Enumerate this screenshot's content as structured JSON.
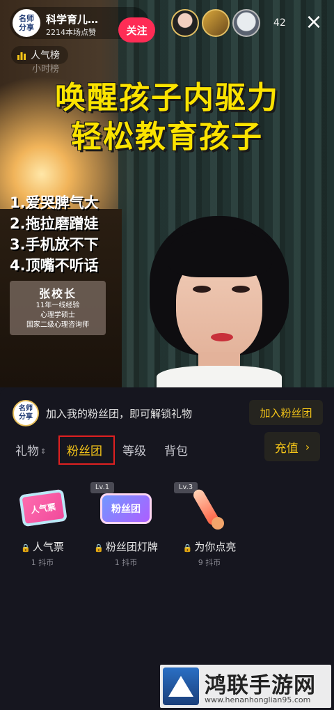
{
  "header": {
    "host_avatar_line1": "名师",
    "host_avatar_line2": "分享",
    "host_name": "科学育儿…",
    "host_likes": "2214本场点赞",
    "follow_label": "关注",
    "viewer_count": "42",
    "close_icon": "×"
  },
  "rank": {
    "label": "人气榜",
    "sub": "小时榜"
  },
  "video": {
    "headline_1": "唤醒孩子内驱力",
    "headline_2": "轻松教育孩子",
    "points": [
      "1.爱哭脾气大",
      "2.拖拉磨蹭娃",
      "3.手机放不下",
      "4.顶嘴不听话"
    ],
    "card_name": "张校长",
    "card_lines": [
      "11年一线经验",
      "心理学硕士",
      "国家二级心理咨询师"
    ]
  },
  "panel": {
    "fan_avatar_line1": "名师",
    "fan_avatar_line2": "分享",
    "fan_hint": "加入我的粉丝团，即可解锁礼物",
    "join_label": "加入粉丝团",
    "tabs": {
      "gift": "礼物",
      "fans": "粉丝团",
      "level": "等级",
      "bag": "背包"
    },
    "recharge_label": "充值",
    "gifts": [
      {
        "name": "人气票",
        "price": "1 抖币",
        "image_text": "人气票",
        "level": ""
      },
      {
        "name": "粉丝团灯牌",
        "price": "1 抖币",
        "image_text": "粉丝团",
        "level": "Lv.1"
      },
      {
        "name": "为你点亮",
        "price": "9 抖币",
        "image_text": "",
        "level": "Lv.3"
      }
    ]
  },
  "watermark": {
    "title": "鸿联手游网",
    "url": "www.henanhonglian95.com"
  },
  "colors": {
    "accent_yellow": "#f5c518",
    "follow_red": "#fe2c55",
    "highlight_box": "#e02020",
    "panel_bg": "#16161f"
  }
}
